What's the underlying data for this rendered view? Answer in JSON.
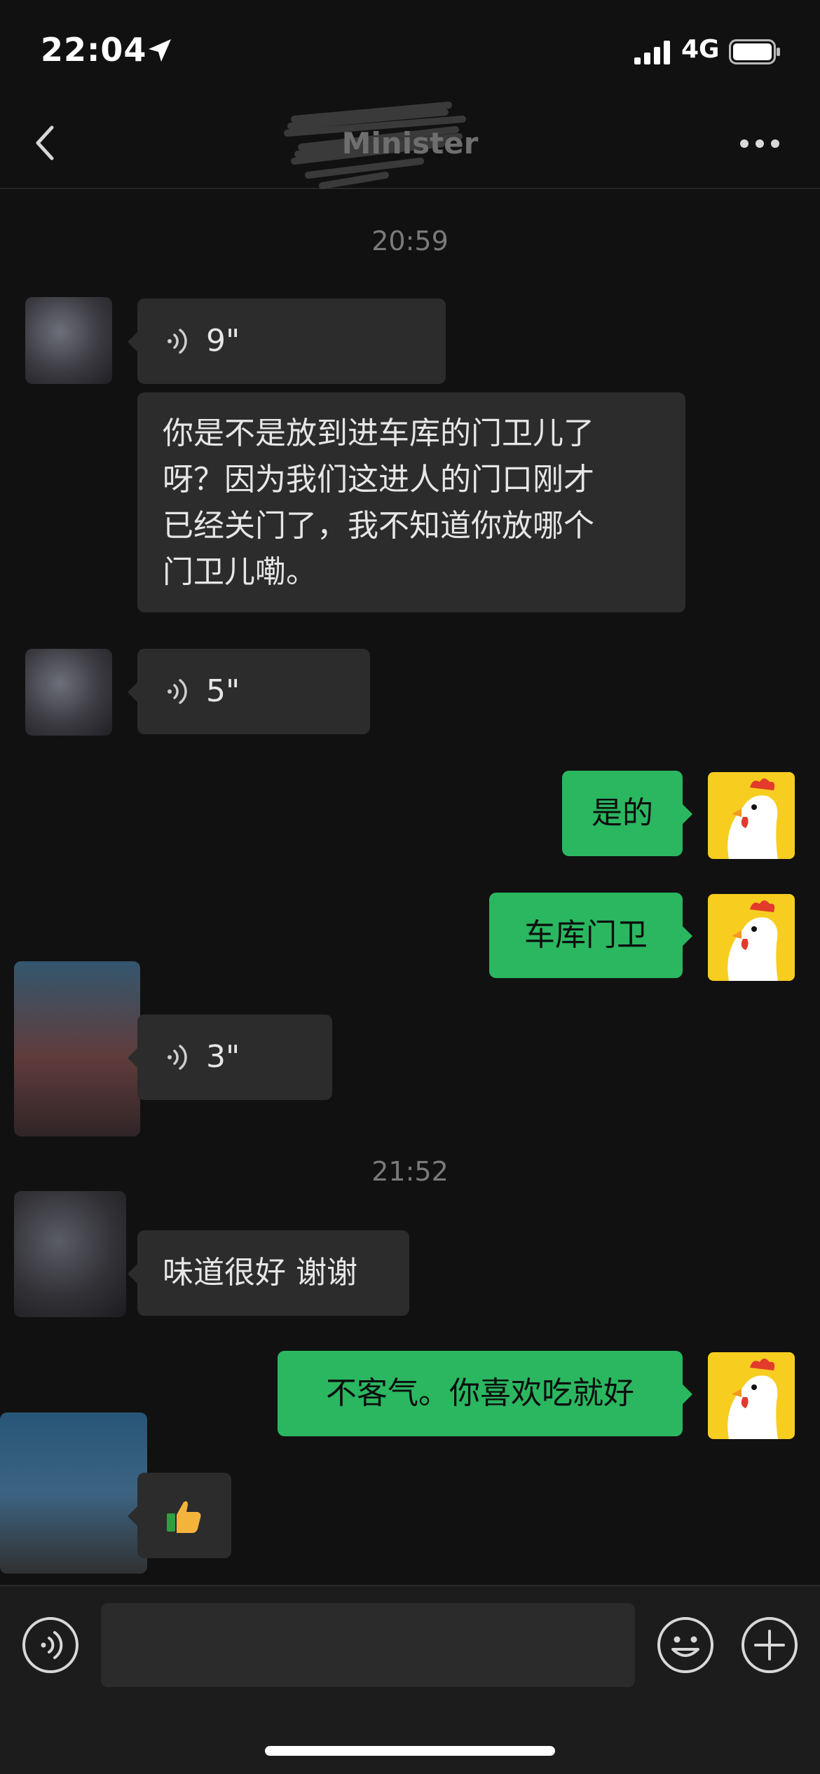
{
  "status_bar": {
    "time": "22:04",
    "network": "4G"
  },
  "header": {
    "title": "Minister"
  },
  "messages": {
    "ts1": "20:59",
    "m1_duration": "9\"",
    "m2_text_l1": "你是不是放到进车库的门卫儿了",
    "m2_text_l2": "呀？因为我们这进人的门口刚才",
    "m2_text_l3": "已经关门了，我不知道你放哪个",
    "m2_text_l4": "门卫儿嘞。",
    "m3_duration": "5\"",
    "m4_text": "是的",
    "m5_text": "车库门卫",
    "m6_duration": "3\"",
    "ts2": "21:52",
    "m7_text": "味道很好 谢谢",
    "m8_text": "不客气。你喜欢吃就好",
    "m9_text": "👍"
  },
  "colors": {
    "bg": "#111111",
    "bubble_in": "#2c2c2c",
    "bubble_out": "#2ab760"
  }
}
